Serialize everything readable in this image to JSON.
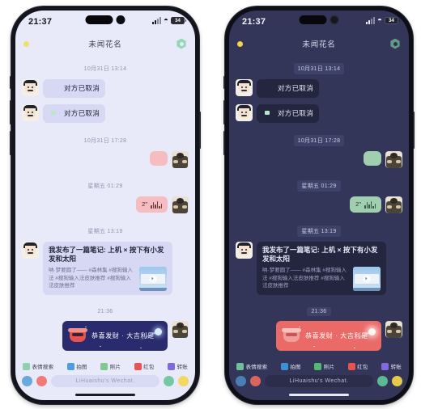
{
  "variants": [
    {
      "theme": "light",
      "status": {
        "time": "21:37",
        "battery": "34",
        "wifi_icon": "wifi-icon",
        "signal_icon": "signal-icon"
      },
      "nav": {
        "back_icon": "back-dot-icon",
        "title": "未闻花名",
        "gear_icon": "gear-icon"
      },
      "messages": [
        {
          "kind": "timestamp",
          "text": "10月31日 13:14"
        },
        {
          "kind": "cancel",
          "side": "in",
          "icon": "red-packet-icon",
          "text": "对方已取消"
        },
        {
          "kind": "cancel",
          "side": "in",
          "icon": "transfer-icon",
          "text": "对方已取消"
        },
        {
          "kind": "timestamp",
          "text": "10月31日 17:28"
        },
        {
          "kind": "tiny",
          "side": "out"
        },
        {
          "kind": "timestamp",
          "text": "星期五 01:29"
        },
        {
          "kind": "voice",
          "side": "out",
          "duration": "2\""
        },
        {
          "kind": "timestamp",
          "text": "星期五 13:19"
        },
        {
          "kind": "note",
          "side": "in",
          "title": "我发布了一篇笔记: 上机 × 按下有小发发和太阳",
          "desc": "呐·梦要圆了—— #森林集 #搜狗输入法 #搜狗输入法皮肤推荐 #搜狗输入法皮肤推荐",
          "thumb_icon": "video-thumbnail-icon"
        },
        {
          "kind": "timestamp",
          "text": "21:36"
        },
        {
          "kind": "hongbao",
          "side": "out",
          "text": "恭喜发财 · 大吉利是",
          "icon": "hongbao-pot-icon"
        }
      ],
      "toolbar": [
        {
          "label": "表情搜索",
          "icon": "sticker-search-icon",
          "color": "#8fd0b3"
        },
        {
          "label": "拍图",
          "icon": "camera-icon",
          "color": "#4d9de0"
        },
        {
          "label": "照片",
          "icon": "photo-icon",
          "color": "#7fc98e"
        },
        {
          "label": "红包",
          "icon": "red-packet-icon",
          "color": "#e8524f"
        },
        {
          "label": "转账",
          "icon": "transfer-icon",
          "color": "#7f6bdd"
        }
      ],
      "input": {
        "placeholder": "LiHuaishu's Wechat.",
        "left_icon": "voice-icon",
        "left_icon2": "keyboard-icon",
        "right_icon": "emoji-icon",
        "right_icon3": "plus-icon"
      }
    },
    {
      "theme": "dark",
      "status": {
        "time": "21:37",
        "battery": "34",
        "wifi_icon": "wifi-icon",
        "signal_icon": "signal-icon"
      },
      "nav": {
        "back_icon": "back-dot-icon",
        "title": "未闻花名",
        "gear_icon": "gear-icon"
      },
      "messages": [
        {
          "kind": "timestamp",
          "text": "10月31日 13:14"
        },
        {
          "kind": "cancel",
          "side": "in",
          "icon": "red-packet-icon",
          "text": "对方已取消"
        },
        {
          "kind": "cancel",
          "side": "in",
          "icon": "transfer-icon",
          "text": "对方已取消"
        },
        {
          "kind": "timestamp",
          "text": "10月31日 17:28"
        },
        {
          "kind": "tiny",
          "side": "out"
        },
        {
          "kind": "timestamp",
          "text": "星期五 01:29"
        },
        {
          "kind": "voice",
          "side": "out",
          "duration": "2\""
        },
        {
          "kind": "timestamp",
          "text": "星期五 13:19"
        },
        {
          "kind": "note",
          "side": "in",
          "title": "我发布了一篇笔记: 上机 × 按下有小发发和太阳",
          "desc": "呐·梦要圆了—— #森林集 #搜狗输入法 #搜狗输入法皮肤推荐 #搜狗输入法皮肤推荐",
          "thumb_icon": "video-thumbnail-icon"
        },
        {
          "kind": "timestamp",
          "text": "21:36"
        },
        {
          "kind": "hongbao",
          "side": "out",
          "text": "恭喜发财 · 大吉利是",
          "icon": "hongbao-pot-icon"
        }
      ],
      "toolbar": [
        {
          "label": "表情搜索",
          "icon": "sticker-search-icon",
          "color": "#6fbf9c"
        },
        {
          "label": "拍图",
          "icon": "camera-icon",
          "color": "#3d8fd6"
        },
        {
          "label": "照片",
          "icon": "photo-icon",
          "color": "#52b872"
        },
        {
          "label": "红包",
          "icon": "red-packet-icon",
          "color": "#e8524f"
        },
        {
          "label": "转账",
          "icon": "transfer-icon",
          "color": "#7f6bdd"
        }
      ],
      "input": {
        "placeholder": "LiHuaishu's Wechat.",
        "left_icon": "voice-icon",
        "left_icon2": "keyboard-icon",
        "right_icon": "emoji-icon",
        "right_icon3": "plus-icon"
      }
    }
  ],
  "theme_colors": {
    "light_bg": "#e9eaf9",
    "dark_bg": "#343659",
    "bubble_in_light": "#d7d8f3",
    "bubble_in_dark": "#24263f",
    "bubble_out_light": "#f5bdc0",
    "bubble_out_dark": "#9fcfae",
    "hongbao_light": "#2a2a6e",
    "hongbao_dark": "#ea6a68",
    "accent_green": "#8fd9b6",
    "accent_yellow": "#f0e06a"
  },
  "labels": {
    "m1_nav_title_alt": "未闻花名",
    "duration_unit": "\""
  }
}
